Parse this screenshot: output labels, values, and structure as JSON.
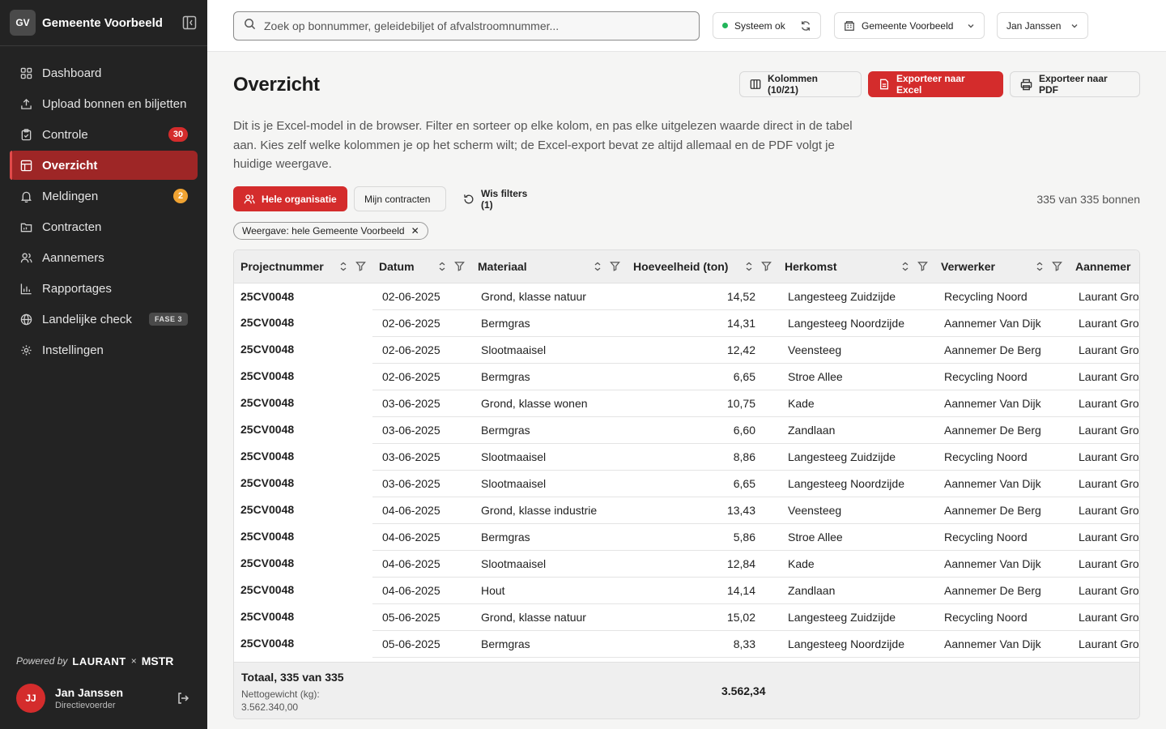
{
  "org": {
    "initials": "GV",
    "name": "Gemeente Voorbeeld"
  },
  "nav": [
    {
      "name": "dashboard",
      "label": "Dashboard",
      "icon": "grid-icon"
    },
    {
      "name": "upload",
      "label": "Upload bonnen en biljetten",
      "icon": "upload-icon"
    },
    {
      "name": "controle",
      "label": "Controle",
      "icon": "clipboard-icon",
      "badge": "30"
    },
    {
      "name": "overzicht",
      "label": "Overzicht",
      "icon": "table-icon",
      "active": true
    },
    {
      "name": "meldingen",
      "label": "Meldingen",
      "icon": "bell-icon",
      "badge": "2"
    },
    {
      "name": "contracten",
      "label": "Contracten",
      "icon": "folder-icon"
    },
    {
      "name": "aannemers",
      "label": "Aannemers",
      "icon": "users-icon"
    },
    {
      "name": "rapportages",
      "label": "Rapportages",
      "icon": "bar-chart-icon"
    },
    {
      "name": "landelijke-check",
      "label": "Landelijke check",
      "icon": "globe-icon",
      "tag": "FASE 3"
    },
    {
      "name": "instellingen",
      "label": "Instellingen",
      "icon": "gear-icon"
    }
  ],
  "powered": {
    "prefix": "Powered by",
    "brand1": "LAURANT",
    "sep": "×",
    "brand2": "MSTR"
  },
  "user": {
    "initials": "JJ",
    "name": "Jan Janssen",
    "role": "Directievoerder"
  },
  "topbar": {
    "search_placeholder": "Zoek op bonnummer, geleidebiljet of afvalstroomnummer...",
    "status": "Systeem ok",
    "org_select": "Gemeente Voorbeeld",
    "user_select": "Jan Janssen"
  },
  "page": {
    "title": "Overzicht",
    "columns_button": "Kolommen (10/21)",
    "export_excel": "Exporteer naar Excel",
    "export_pdf": "Exporteer naar PDF",
    "description": "Dit is je Excel-model in de browser. Filter en sorteer op elke kolom, en pas elke uitgelezen waarde direct in de tabel aan. Kies zelf welke kolommen je op het scherm wilt; de Excel-export bevat ze altijd allemaal en de PDF volgt je huidige weergave.",
    "filter_all": "Hele organisatie",
    "filter_mine": "Mijn contracten",
    "clear_filters": "Wis filters (1)",
    "count": "335 van 335 bonnen",
    "chip": "Weergave: hele Gemeente Voorbeeld"
  },
  "table": {
    "headers": [
      "Projectnummer",
      "Datum",
      "Materiaal",
      "Hoeveelheid (ton)",
      "Herkomst",
      "Verwerker",
      "Aannemer"
    ],
    "rows": [
      [
        "25CV0048",
        "02-06-2025",
        "Grond, klasse natuur",
        "14,52",
        "Langesteeg Zuidzijde",
        "Recycling Noord",
        "Laurant Groep"
      ],
      [
        "25CV0048",
        "02-06-2025",
        "Bermgras",
        "14,31",
        "Langesteeg Noordzijde",
        "Aannemer Van Dijk",
        "Laurant Groep"
      ],
      [
        "25CV0048",
        "02-06-2025",
        "Slootmaaisel",
        "12,42",
        "Veensteeg",
        "Aannemer De Berg",
        "Laurant Groep"
      ],
      [
        "25CV0048",
        "02-06-2025",
        "Bermgras",
        "6,65",
        "Stroe Allee",
        "Recycling Noord",
        "Laurant Groep"
      ],
      [
        "25CV0048",
        "03-06-2025",
        "Grond, klasse wonen",
        "10,75",
        "Kade",
        "Aannemer Van Dijk",
        "Laurant Groep"
      ],
      [
        "25CV0048",
        "03-06-2025",
        "Bermgras",
        "6,60",
        "Zandlaan",
        "Aannemer De Berg",
        "Laurant Groep"
      ],
      [
        "25CV0048",
        "03-06-2025",
        "Slootmaaisel",
        "8,86",
        "Langesteeg Zuidzijde",
        "Recycling Noord",
        "Laurant Groep"
      ],
      [
        "25CV0048",
        "03-06-2025",
        "Slootmaaisel",
        "6,65",
        "Langesteeg Noordzijde",
        "Aannemer Van Dijk",
        "Laurant Groep"
      ],
      [
        "25CV0048",
        "04-06-2025",
        "Grond, klasse industrie",
        "13,43",
        "Veensteeg",
        "Aannemer De Berg",
        "Laurant Groep"
      ],
      [
        "25CV0048",
        "04-06-2025",
        "Bermgras",
        "5,86",
        "Stroe Allee",
        "Recycling Noord",
        "Laurant Groep"
      ],
      [
        "25CV0048",
        "04-06-2025",
        "Slootmaaisel",
        "12,84",
        "Kade",
        "Aannemer Van Dijk",
        "Laurant Groep"
      ],
      [
        "25CV0048",
        "04-06-2025",
        "Hout",
        "14,14",
        "Zandlaan",
        "Aannemer De Berg",
        "Laurant Groep"
      ],
      [
        "25CV0048",
        "05-06-2025",
        "Grond, klasse natuur",
        "15,02",
        "Langesteeg Zuidzijde",
        "Recycling Noord",
        "Laurant Groep"
      ],
      [
        "25CV0048",
        "05-06-2025",
        "Bermgras",
        "8,33",
        "Langesteeg Noordzijde",
        "Aannemer Van Dijk",
        "Laurant Groep"
      ]
    ],
    "footer": {
      "title": "Totaal, 335 van 335",
      "subtitle": "Nettogewicht (kg): 3.562.340,00",
      "total": "3.562,34"
    }
  },
  "colors": {
    "accent": "#d42c2c",
    "sidebar": "#232323",
    "active_nav": "#9e2626",
    "ok": "#22b55a",
    "warn": "#f0a332"
  }
}
